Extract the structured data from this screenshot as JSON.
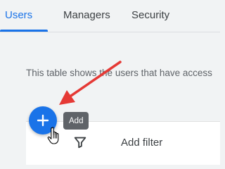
{
  "tabs": [
    {
      "label": "Users",
      "active": true
    },
    {
      "label": "Managers",
      "active": false
    },
    {
      "label": "Security",
      "active": false
    }
  ],
  "description": "This table shows the users that have access",
  "filter": {
    "label": "Add filter",
    "icon": "filter-icon"
  },
  "fab": {
    "icon": "plus-icon",
    "tooltip": "Add"
  },
  "colors": {
    "accent": "#1a73e8",
    "annotation_arrow": "#e53935",
    "tooltip_bg": "#5f6368"
  }
}
